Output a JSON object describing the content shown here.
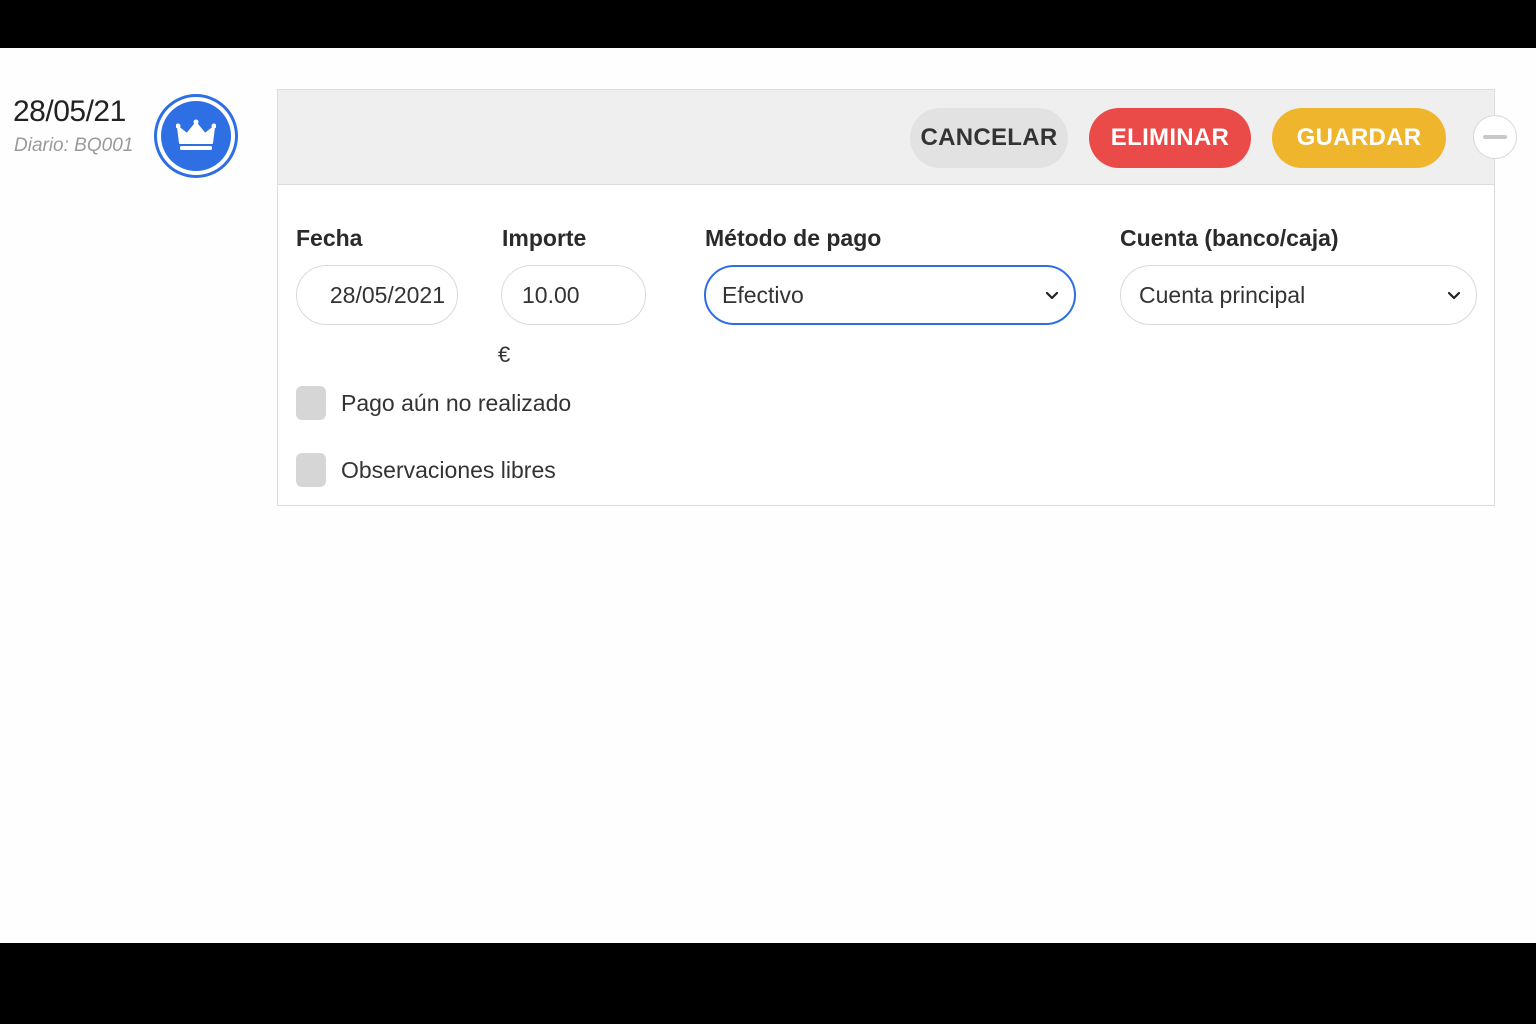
{
  "entry": {
    "date": "28/05/21",
    "journal": "Diario: BQ001",
    "badge_icon": "crown-icon",
    "accent_color": "#2f6fe4"
  },
  "toolbar": {
    "cancel_label": "CANCELAR",
    "delete_label": "ELIMINAR",
    "save_label": "GUARDAR",
    "collapse_icon": "minus-icon"
  },
  "form": {
    "date": {
      "label": "Fecha",
      "value": "28/05/2021"
    },
    "amount": {
      "label": "Importe",
      "value": "10.00",
      "currency": "€"
    },
    "payment_method": {
      "label": "Método de pago",
      "selected": "Efectivo"
    },
    "account": {
      "label": "Cuenta (banco/caja)",
      "selected": "Cuenta principal"
    },
    "checkboxes": [
      {
        "label": "Pago aún no realizado",
        "checked": false
      },
      {
        "label": "Observaciones libres",
        "checked": false
      }
    ]
  },
  "colors": {
    "cancel": "#e2e2e2",
    "delete": "#ea4a48",
    "save": "#efb52c"
  }
}
